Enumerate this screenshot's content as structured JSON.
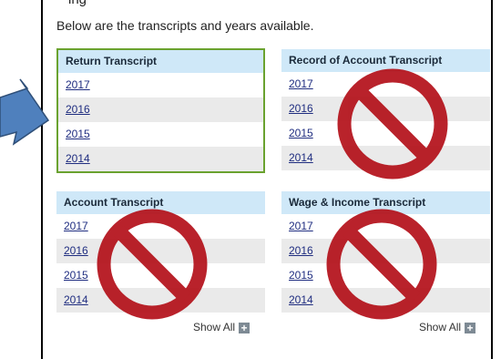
{
  "header": {
    "partial_text": "ing",
    "intro": "Below are the transcripts and years available."
  },
  "panels": [
    {
      "title": "Return Transcript",
      "years": [
        "2017",
        "2016",
        "2015",
        "2014"
      ]
    },
    {
      "title": "Record of Account Transcript",
      "years": [
        "2017",
        "2016",
        "2015",
        "2014"
      ]
    },
    {
      "title": "Account Transcript",
      "years": [
        "2017",
        "2016",
        "2015",
        "2014"
      ],
      "show_all": "Show All"
    },
    {
      "title": "Wage & Income Transcript",
      "years": [
        "2017",
        "2016",
        "2015",
        "2014"
      ],
      "show_all": "Show All"
    }
  ],
  "icons": {
    "plus": "+",
    "prohibition": "prohibition-icon",
    "arrow": "arrow-right-icon"
  },
  "colors": {
    "highlight_border": "#6aa22f",
    "header_bg": "#cfe8f8",
    "prohibition_red": "#b4121b",
    "arrow_fill": "#4f80bd"
  }
}
